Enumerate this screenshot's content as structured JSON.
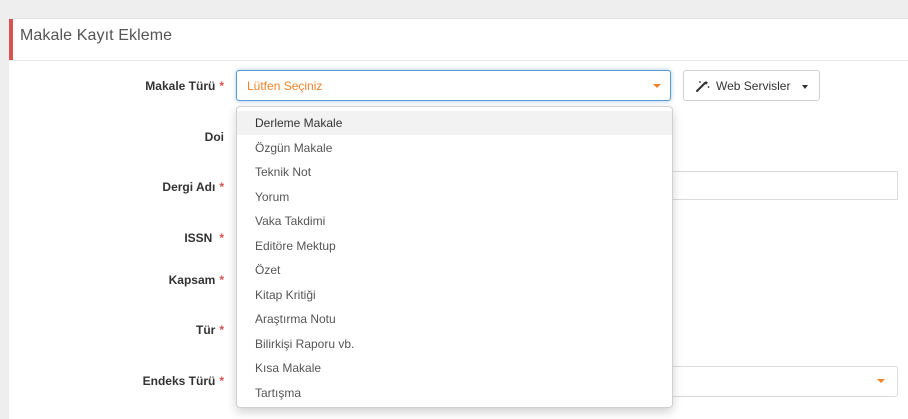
{
  "form": {
    "title": "Makale Kayıt Ekleme",
    "required_marker": "*",
    "labels": {
      "makale_turu": "Makale Türü",
      "doi": "Doi",
      "dergi_adi": "Dergi Adı",
      "issn": "ISSN",
      "kapsam": "Kapsam",
      "tur": "Tür",
      "endeks_turu": "Endeks Türü"
    },
    "makale_turu_value": "Lütfen Seçiniz",
    "web_servisler_label": "Web Servisler"
  },
  "dropdown": {
    "options": [
      "Derleme Makale",
      "Özgün Makale",
      "Teknik Not",
      "Yorum",
      "Vaka Takdimi",
      "Editöre Mektup",
      "Özet",
      "Kitap Kritiği",
      "Araştırma Notu",
      "Bilirkişi Raporu vb.",
      "Kısa Makale",
      "Tartışma"
    ],
    "highlighted": "Derleme Makale"
  },
  "icons": {
    "web_servisler": "magic-wand-icon",
    "select_caret": "caret-down-icon"
  },
  "colors": {
    "accent": "#d9534f",
    "placeholder_text": "#f0832b",
    "focus_border": "#5b9bd5"
  }
}
